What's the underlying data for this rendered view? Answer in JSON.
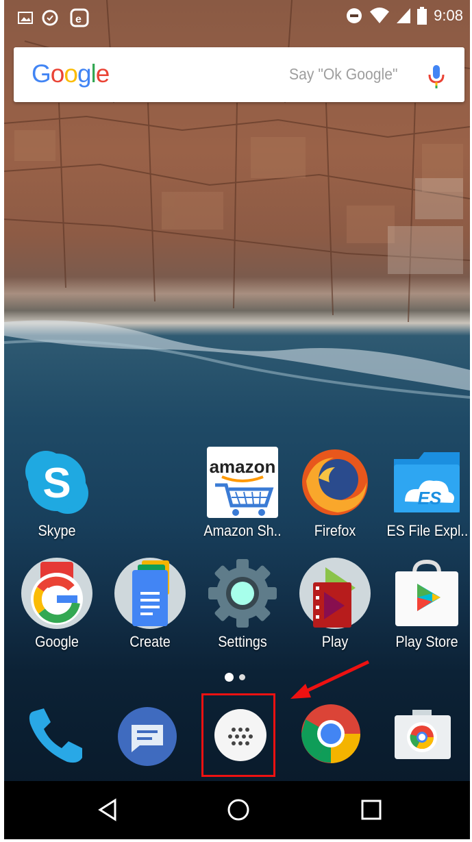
{
  "status_bar": {
    "time": "9:08",
    "left_icons": [
      "image-icon",
      "sync-icon",
      "e-icon"
    ],
    "right_icons": [
      "do-not-disturb-icon",
      "wifi-icon",
      "signal-icon",
      "battery-icon"
    ]
  },
  "search": {
    "logo": "Google",
    "hint": "Say \"Ok Google\"",
    "logo_colors": [
      "#4285F4",
      "#EA4335",
      "#FBBC05",
      "#4285F4",
      "#34A853",
      "#EA4335"
    ]
  },
  "apps_row1": [
    {
      "label": "Skype",
      "icon": "skype-icon"
    },
    {
      "label": "Amazon Sh..",
      "icon": "amazon-icon"
    },
    {
      "label": "Firefox",
      "icon": "firefox-icon"
    },
    {
      "label": "ES File Expl..",
      "icon": "es-file-explorer-icon"
    }
  ],
  "apps_row2": [
    {
      "label": "Google",
      "icon": "google-folder-icon"
    },
    {
      "label": "Create",
      "icon": "docs-folder-icon"
    },
    {
      "label": "Settings",
      "icon": "settings-icon"
    },
    {
      "label": "Play",
      "icon": "play-folder-icon"
    },
    {
      "label": "Play Store",
      "icon": "play-store-icon"
    }
  ],
  "amazon_wordmark": "amazon",
  "es_mark": "ES",
  "dock": [
    {
      "icon": "phone-icon"
    },
    {
      "icon": "messages-icon"
    },
    {
      "icon": "app-drawer-icon"
    },
    {
      "icon": "chrome-icon"
    },
    {
      "icon": "camera-icon"
    }
  ],
  "annotation": {
    "color": "#E11111",
    "target": "app-drawer-icon"
  },
  "navigation": {
    "buttons": [
      "back-icon",
      "home-icon",
      "recents-icon"
    ]
  }
}
